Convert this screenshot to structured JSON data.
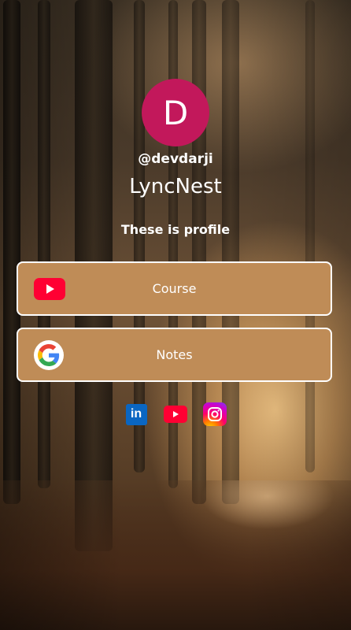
{
  "profile": {
    "avatar_letter": "D",
    "avatar_color": "#c2185b",
    "username": "@devdarji",
    "title": "LyncNest",
    "bio": "These is profile"
  },
  "links": [
    {
      "label": "Course",
      "icon": "youtube-icon"
    },
    {
      "label": "Notes",
      "icon": "google-icon"
    }
  ],
  "socials": [
    {
      "icon": "linkedin-icon"
    },
    {
      "icon": "youtube-icon"
    },
    {
      "icon": "instagram-icon"
    }
  ],
  "theme": {
    "button_bg": "#bf8c57",
    "button_border": "#ffffff",
    "text_color": "#ffffff"
  }
}
